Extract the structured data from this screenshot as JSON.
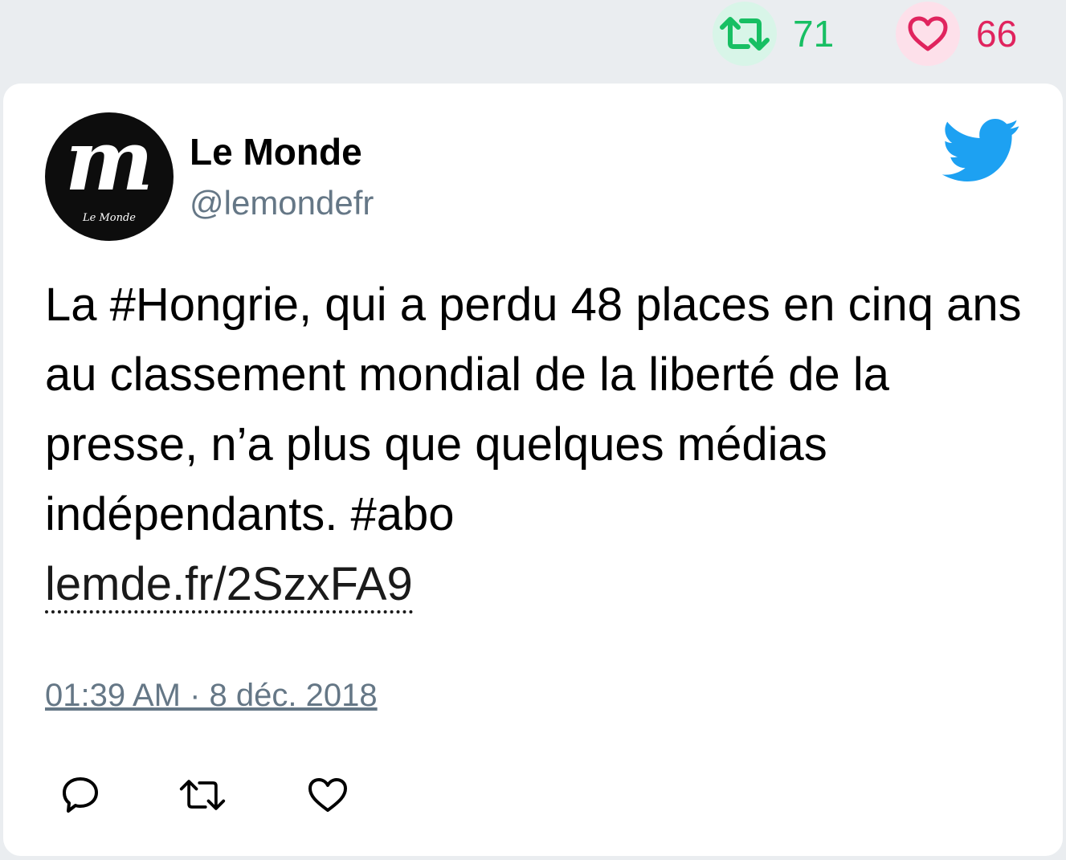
{
  "stats": {
    "retweets": "71",
    "likes": "66",
    "retweet_color": "#17bf63",
    "like_color": "#e0245e"
  },
  "author": {
    "name": "Le Monde",
    "handle": "@lemondefr",
    "avatar_letter": "m",
    "avatar_caption": "Le Monde"
  },
  "tweet": {
    "text": "La #Hongrie, qui a perdu 48 places en cinq ans au classement mondial de la liberté de la presse, n’a plus que quelques médias indépendants. #abo",
    "link": "lemde.fr/2SzxFA9",
    "timestamp": "01:39 AM · 8 déc. 2018"
  },
  "icons": {
    "retweet": "retweet-icon",
    "like": "heart-icon",
    "reply": "reply-icon",
    "brand": "twitter-bird-icon"
  }
}
